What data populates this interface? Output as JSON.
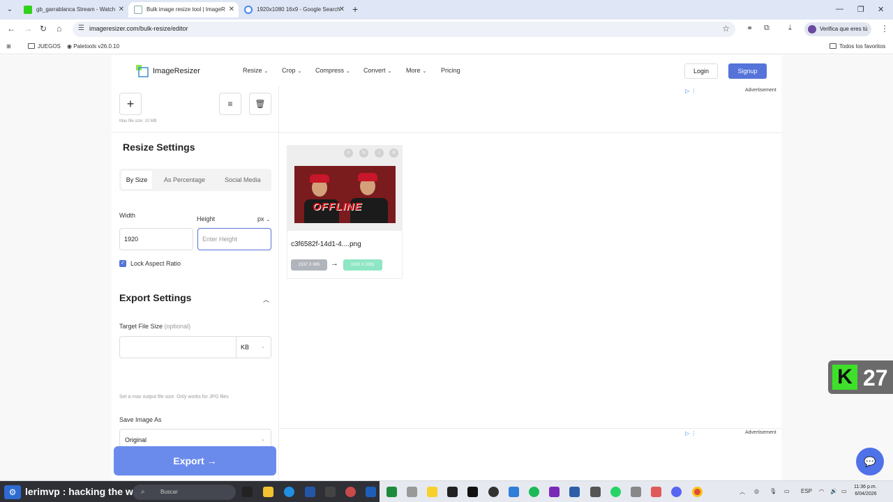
{
  "browser": {
    "tabs": [
      {
        "title": "gb_garrablanca Stream - Watch",
        "active": false
      },
      {
        "title": "Bulk image resize tool | ImageR",
        "active": true
      },
      {
        "title": "1920x1080 16x9 - Google Search",
        "active": false
      }
    ],
    "url": "imageresizer.com/bulk-resize/editor",
    "profile_label": "Verifica que eres tú",
    "bookmarks": [
      "JUEGOS",
      "Paletools v26.0.10"
    ],
    "all_bookmarks": "Todos los favoritos"
  },
  "site": {
    "logo_text": "ImageResizer",
    "nav": [
      "Resize",
      "Crop",
      "Compress",
      "Convert",
      "More",
      "Pricing"
    ],
    "login": "Login",
    "signup": "Signup",
    "advertisement": "Advertisement"
  },
  "sidebar": {
    "max_file_size": "Max file size: 10 MB",
    "resize_title": "Resize Settings",
    "tabs": [
      "By Size",
      "As Percentage",
      "Social Media"
    ],
    "active_tab": "By Size",
    "width_label": "Width",
    "height_label": "Height",
    "unit": "px",
    "width_value": "1920",
    "height_placeholder": "Enter Height",
    "lock_aspect": "Lock Aspect Ratio",
    "lock_checked": true,
    "export_title": "Export Settings",
    "target_size_label": "Target File Size",
    "optional": "(optional)",
    "size_unit": "KB",
    "size_hint": "Set a max output file size. Only works for JPG files",
    "save_as_label": "Save Image As",
    "save_as_value": "Original",
    "export_button": "Export →"
  },
  "card": {
    "filename": "c3f6582f-14d1-4....png",
    "original_dims": "1537 X 865",
    "new_dims": "1920 X 1081",
    "thumb_text": "OFFLINE"
  },
  "overlay": {
    "kick_number": "27",
    "stream_text": "lerimvp : hacking the web",
    "search_label": "Buscar"
  },
  "system": {
    "lang": "ESP",
    "time": "11:36 p.m.",
    "date": "6/04/2026"
  }
}
